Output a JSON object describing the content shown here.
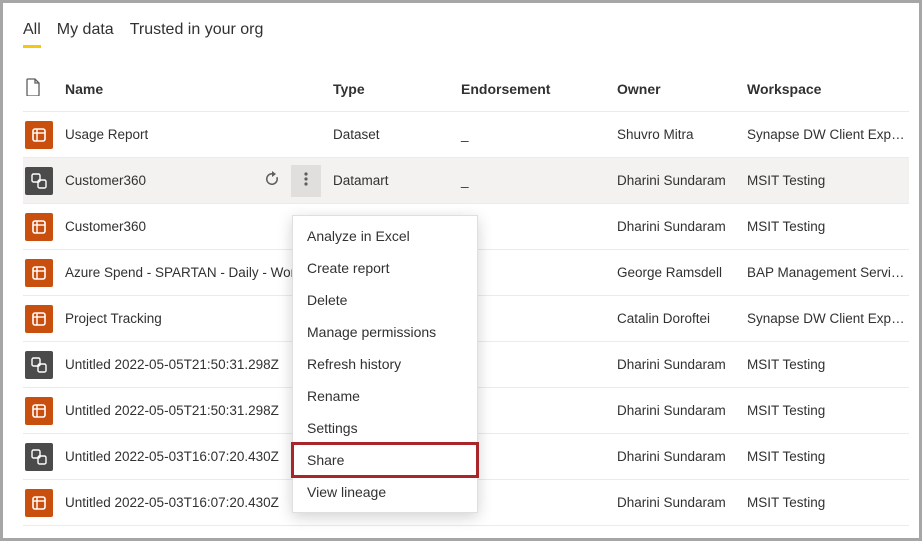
{
  "tabs": {
    "all": "All",
    "mydata": "My data",
    "trusted": "Trusted in your org"
  },
  "columns": {
    "name": "Name",
    "type": "Type",
    "endorsement": "Endorsement",
    "owner": "Owner",
    "workspace": "Workspace"
  },
  "rows": [
    {
      "name": "Usage Report",
      "type": "Dataset",
      "endorsement": "_",
      "owner": "Shuvro Mitra",
      "workspace": "Synapse DW Client Experi...",
      "iconTile": "orange",
      "icon": "dataset"
    },
    {
      "name": "Customer360",
      "type": "Datamart",
      "endorsement": "_",
      "owner": "Dharini Sundaram",
      "workspace": "MSIT Testing",
      "iconTile": "dark",
      "icon": "datamart",
      "hovered": true
    },
    {
      "name": "Customer360",
      "type": "",
      "endorsement": "",
      "owner": "Dharini Sundaram",
      "workspace": "MSIT Testing",
      "iconTile": "orange",
      "icon": "dataset"
    },
    {
      "name": "Azure Spend - SPARTAN - Daily - Workspace",
      "type": "",
      "endorsement": "",
      "owner": "George Ramsdell",
      "workspace": "BAP Management Services",
      "iconTile": "orange",
      "icon": "dataset"
    },
    {
      "name": "Project Tracking",
      "type": "",
      "endorsement": "",
      "owner": "Catalin Doroftei",
      "workspace": "Synapse DW Client Experi...",
      "iconTile": "orange",
      "icon": "dataset"
    },
    {
      "name": "Untitled 2022-05-05T21:50:31.298Z",
      "type": "",
      "endorsement": "",
      "owner": "Dharini Sundaram",
      "workspace": "MSIT Testing",
      "iconTile": "dark",
      "icon": "datamart"
    },
    {
      "name": "Untitled 2022-05-05T21:50:31.298Z",
      "type": "",
      "endorsement": "",
      "owner": "Dharini Sundaram",
      "workspace": "MSIT Testing",
      "iconTile": "orange",
      "icon": "dataset"
    },
    {
      "name": "Untitled 2022-05-03T16:07:20.430Z",
      "type": "",
      "endorsement": "",
      "owner": "Dharini Sundaram",
      "workspace": "MSIT Testing",
      "iconTile": "dark",
      "icon": "datamart"
    },
    {
      "name": "Untitled 2022-05-03T16:07:20.430Z",
      "type": "",
      "endorsement": "",
      "owner": "Dharini Sundaram",
      "workspace": "MSIT Testing",
      "iconTile": "orange",
      "icon": "dataset"
    }
  ],
  "contextMenu": {
    "items": [
      "Analyze in Excel",
      "Create report",
      "Delete",
      "Manage permissions",
      "Refresh history",
      "Rename",
      "Settings",
      "Share",
      "View lineage"
    ],
    "highlightIndex": 7
  }
}
